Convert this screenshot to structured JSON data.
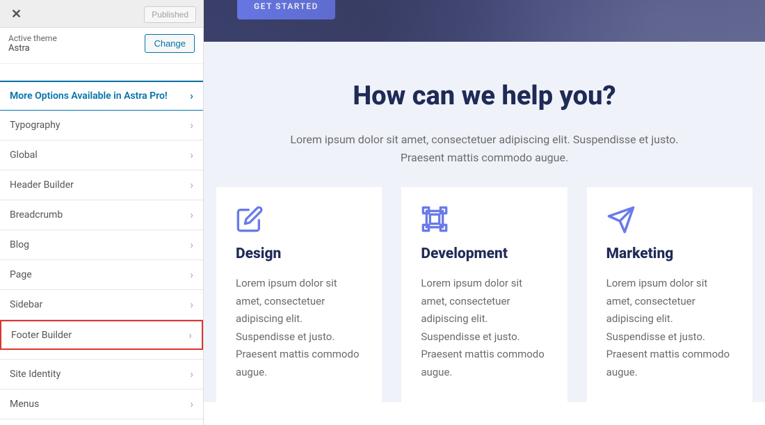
{
  "topbar": {
    "published": "Published"
  },
  "theme": {
    "label": "Active theme",
    "name": "Astra",
    "change": "Change"
  },
  "promo": "More Options Available in Astra Pro!",
  "menu": {
    "typography": "Typography",
    "global": "Global",
    "header_builder": "Header Builder",
    "breadcrumb": "Breadcrumb",
    "blog": "Blog",
    "page": "Page",
    "sidebar": "Sidebar",
    "footer_builder": "Footer Builder",
    "site_identity": "Site Identity",
    "menus": "Menus"
  },
  "hero": {
    "cta": "GET STARTED"
  },
  "help": {
    "title": "How can we help you?",
    "subtitle": "Lorem ipsum dolor sit amet, consectetuer adipiscing elit. Suspendisse et justo. Praesent mattis commodo augue."
  },
  "cards": {
    "design": {
      "title": "Design",
      "body": "Lorem ipsum dolor sit amet, consectetuer adipiscing elit. Suspendisse et justo. Praesent mattis commodo augue."
    },
    "development": {
      "title": "Development",
      "body": "Lorem ipsum dolor sit amet, consectetuer adipiscing elit. Suspendisse et justo. Praesent mattis commodo augue."
    },
    "marketing": {
      "title": "Marketing",
      "body": "Lorem ipsum dolor sit amet, consectetuer adipiscing elit. Suspendisse et justo. Praesent mattis commodo augue."
    }
  }
}
